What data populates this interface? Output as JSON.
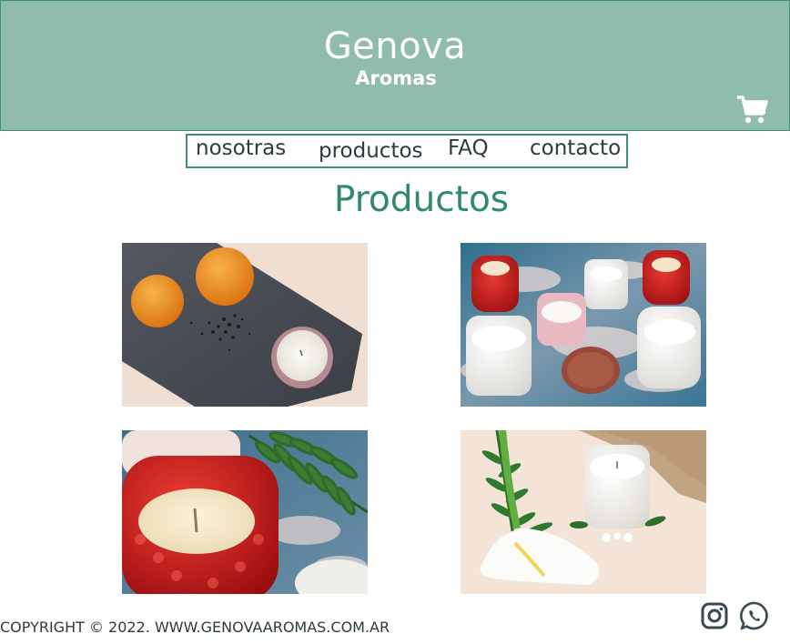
{
  "brand": {
    "name": "Genova",
    "subtitle": "Aromas"
  },
  "header": {
    "cart_icon": "cart-icon"
  },
  "nav": {
    "items": [
      {
        "label": "nosotras"
      },
      {
        "label": "productos"
      },
      {
        "label": "FAQ"
      },
      {
        "label": "contacto"
      }
    ]
  },
  "main": {
    "title": "Productos",
    "products": [
      {
        "image": "candle with oranges and pepper on slate board"
      },
      {
        "image": "assorted red and white glass candles"
      },
      {
        "image": "red hobnail glass candle close-up with fern"
      },
      {
        "image": "white candle with calla lily and fern"
      }
    ]
  },
  "footer": {
    "copyright": "COPYRIGHT © 2022. WWW.GENOVAAROMAS.COM.AR",
    "social": [
      "instagram-icon",
      "whatsapp-icon"
    ]
  },
  "colors": {
    "header_bg": "#8fbcad",
    "accent": "#2f8a6d",
    "border": "#3f8f73",
    "text": "#2c3b3e"
  }
}
